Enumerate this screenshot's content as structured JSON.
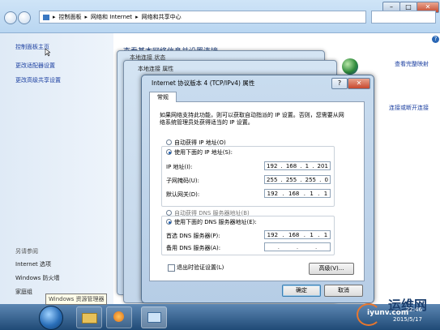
{
  "explorer": {
    "breadcrumb": [
      "控制面板",
      "网络和 Internet",
      "网络和共享中心"
    ],
    "help_glyph": "?"
  },
  "left_pane": {
    "links": [
      "控制面板主页",
      "更改适配器设置",
      "更改高级共享设置"
    ],
    "see_also_title": "另请参阅",
    "see_also": [
      "Internet 选项",
      "Windows 防火墙",
      "家庭组"
    ]
  },
  "main": {
    "heading_fragment": "查看基本网络信息并设置连接",
    "view_full_map": "查看完整映射",
    "connect_disconnect": "连接或断开连接"
  },
  "back_dialogs": {
    "status_title_fragment": "本地连接 状态",
    "properties_title": "本地连接 属性"
  },
  "dialog": {
    "title": "Internet 协议版本 4 (TCP/IPv4) 属性",
    "tab_general": "常规",
    "description": "如果网络支持此功能，则可以获取自动指派的 IP 设置。否则，您需要从网络系统管理员处获得适当的 IP 设置。",
    "radio_auto_ip": "自动获得 IP 地址(O)",
    "radio_manual_ip": "使用下面的 IP 地址(S):",
    "ip_label": "IP 地址(I):",
    "ip_value": [
      "192",
      "168",
      "1",
      "201"
    ],
    "mask_label": "子网掩码(U):",
    "mask_value": [
      "255",
      "255",
      "255",
      "0"
    ],
    "gateway_label": "默认网关(D):",
    "gateway_value": [
      "192",
      "168",
      "1",
      "1"
    ],
    "radio_auto_dns": "自动获得 DNS 服务器地址(B)",
    "radio_manual_dns": "使用下面的 DNS 服务器地址(E):",
    "dns1_label": "首选 DNS 服务器(P):",
    "dns1_value": [
      "192",
      "168",
      "1",
      "1"
    ],
    "dns2_label": "备用 DNS 服务器(A):",
    "dns2_value": [
      "",
      "",
      "",
      ""
    ],
    "checkbox_validate": "退出时验证设置(L)",
    "advanced_button": "高级(V)...",
    "ok_button": "确定",
    "cancel_button": "取消"
  },
  "taskbar": {
    "tooltip": "Windows 资源管理器",
    "clock_time": "22:46",
    "clock_date": "2015/5/17"
  },
  "watermark": {
    "site": "运维网",
    "url": "iyunv.com"
  }
}
